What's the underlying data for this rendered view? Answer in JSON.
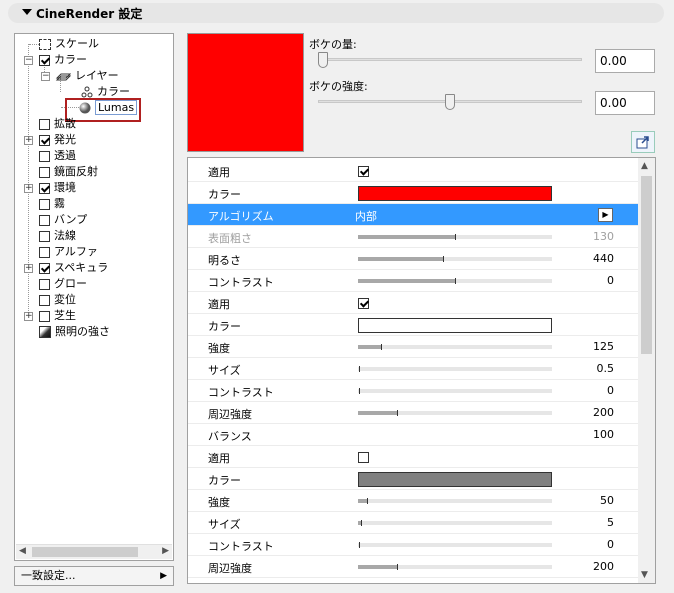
{
  "panel": {
    "title": "CineRender 設定"
  },
  "tree": {
    "items": [
      {
        "label": "スケール"
      },
      {
        "label": "カラー"
      },
      {
        "label": "レイヤー"
      },
      {
        "label": "カラー"
      },
      {
        "label": "Lumas"
      },
      {
        "label": "拡散"
      },
      {
        "label": "発光"
      },
      {
        "label": "透過"
      },
      {
        "label": "鏡面反射"
      },
      {
        "label": "環境"
      },
      {
        "label": "霧"
      },
      {
        "label": "バンプ"
      },
      {
        "label": "法線"
      },
      {
        "label": "アルファ"
      },
      {
        "label": "スペキュラ"
      },
      {
        "label": "グロー"
      },
      {
        "label": "変位"
      },
      {
        "label": "芝生"
      },
      {
        "label": "照明の強さ"
      }
    ]
  },
  "preset": {
    "label": "一致設定..."
  },
  "bokeh": {
    "amount_label": "ボケの量:",
    "amount_value": "0.00",
    "strength_label": "ボケの強度:",
    "strength_value": "0.00"
  },
  "swatch_color": "#ff0000",
  "props": {
    "rows": [
      {
        "label": "適用",
        "value": ""
      },
      {
        "label": "カラー",
        "value": ""
      },
      {
        "label": "アルゴリズム",
        "value": "内部"
      },
      {
        "label": "表面粗さ",
        "value": "130"
      },
      {
        "label": "明るさ",
        "value": "440"
      },
      {
        "label": "コントラスト",
        "value": "0"
      },
      {
        "label": "適用",
        "value": ""
      },
      {
        "label": "カラー",
        "value": ""
      },
      {
        "label": "強度",
        "value": "125"
      },
      {
        "label": "サイズ",
        "value": "0.5"
      },
      {
        "label": "コントラスト",
        "value": "0"
      },
      {
        "label": "周辺強度",
        "value": "200"
      },
      {
        "label": "バランス",
        "value": "100"
      },
      {
        "label": "適用",
        "value": ""
      },
      {
        "label": "カラー",
        "value": ""
      },
      {
        "label": "強度",
        "value": "50"
      },
      {
        "label": "サイズ",
        "value": "5"
      },
      {
        "label": "コントラスト",
        "value": "0"
      },
      {
        "label": "周辺強度",
        "value": "200"
      }
    ]
  }
}
